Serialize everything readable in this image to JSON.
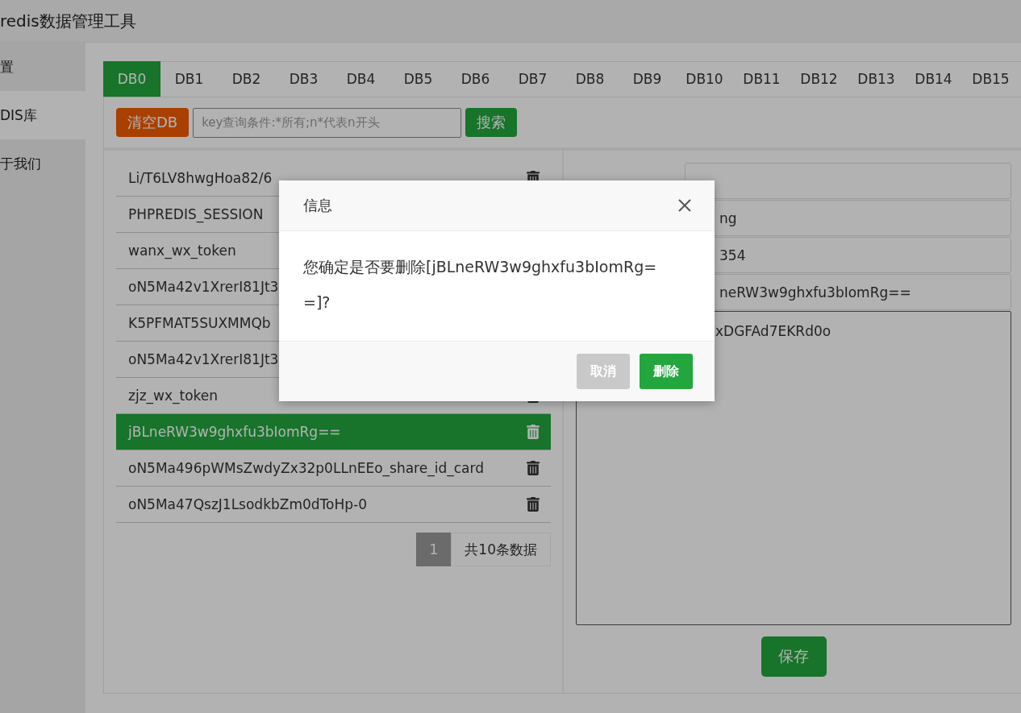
{
  "app": {
    "title": "redis数据管理工具"
  },
  "sidebar": {
    "items": [
      {
        "label": "置",
        "selected": false
      },
      {
        "label": "DIS库",
        "selected": true
      },
      {
        "label": "于我们",
        "selected": false
      }
    ]
  },
  "db_tabs": [
    {
      "label": "DB0",
      "selected": true
    },
    {
      "label": "DB1",
      "selected": false
    },
    {
      "label": "DB2",
      "selected": false
    },
    {
      "label": "DB3",
      "selected": false
    },
    {
      "label": "DB4",
      "selected": false
    },
    {
      "label": "DB5",
      "selected": false
    },
    {
      "label": "DB6",
      "selected": false
    },
    {
      "label": "DB7",
      "selected": false
    },
    {
      "label": "DB8",
      "selected": false
    },
    {
      "label": "DB9",
      "selected": false
    },
    {
      "label": "DB10",
      "selected": false
    },
    {
      "label": "DB11",
      "selected": false
    },
    {
      "label": "DB12",
      "selected": false
    },
    {
      "label": "DB13",
      "selected": false
    },
    {
      "label": "DB14",
      "selected": false
    },
    {
      "label": "DB15",
      "selected": false
    }
  ],
  "toolbar": {
    "clear_button": "清空DB",
    "search": {
      "placeholder": "key查询条件:*所有;n*代表n开头"
    },
    "search_button": "搜索"
  },
  "keys": [
    {
      "name": "Li/T6LV8hwgHoa82/6",
      "selected": false
    },
    {
      "name": "PHPREDIS_SESSION",
      "selected": false,
      "trash_hidden": true
    },
    {
      "name": "wanx_wx_token",
      "selected": false,
      "trash_hidden": true
    },
    {
      "name": "oN5Ma42v1XrerI81Jt3",
      "selected": false,
      "trash_hidden": true
    },
    {
      "name": "K5PFMAT5SUXMMQb",
      "selected": false,
      "trash_hidden": true
    },
    {
      "name": "oN5Ma42v1XrerI81Jt3",
      "selected": false
    },
    {
      "name": "zjz_wx_token",
      "selected": false
    },
    {
      "name": "jBLneRW3w9ghxfu3bIomRg==",
      "selected": true
    },
    {
      "name": "oN5Ma496pWMsZwdyZx32p0LLnEEo_share_id_card",
      "selected": false
    },
    {
      "name": "oN5Ma47QszJ1LsodkbZm0dToHp-0",
      "selected": false
    }
  ],
  "pagination": {
    "pages": [
      {
        "label": "1",
        "selected": true
      }
    ],
    "total": "共10条数据"
  },
  "detail": {
    "fields": [
      {
        "value": "ng"
      },
      {
        "value": "354"
      },
      {
        "value": "neRW3w9ghxfu3bIomRg=="
      }
    ],
    "content": "xDGFAd7EKRd0o",
    "save_button": "保存"
  },
  "dialog": {
    "title": "信息",
    "message": "您确定是否要删除[jBLneRW3w9ghxfu3bIomRg==]?",
    "buttons": [
      {
        "label": "取消",
        "kind": "cancel"
      },
      {
        "label": "删除",
        "kind": "confirm"
      }
    ]
  }
}
